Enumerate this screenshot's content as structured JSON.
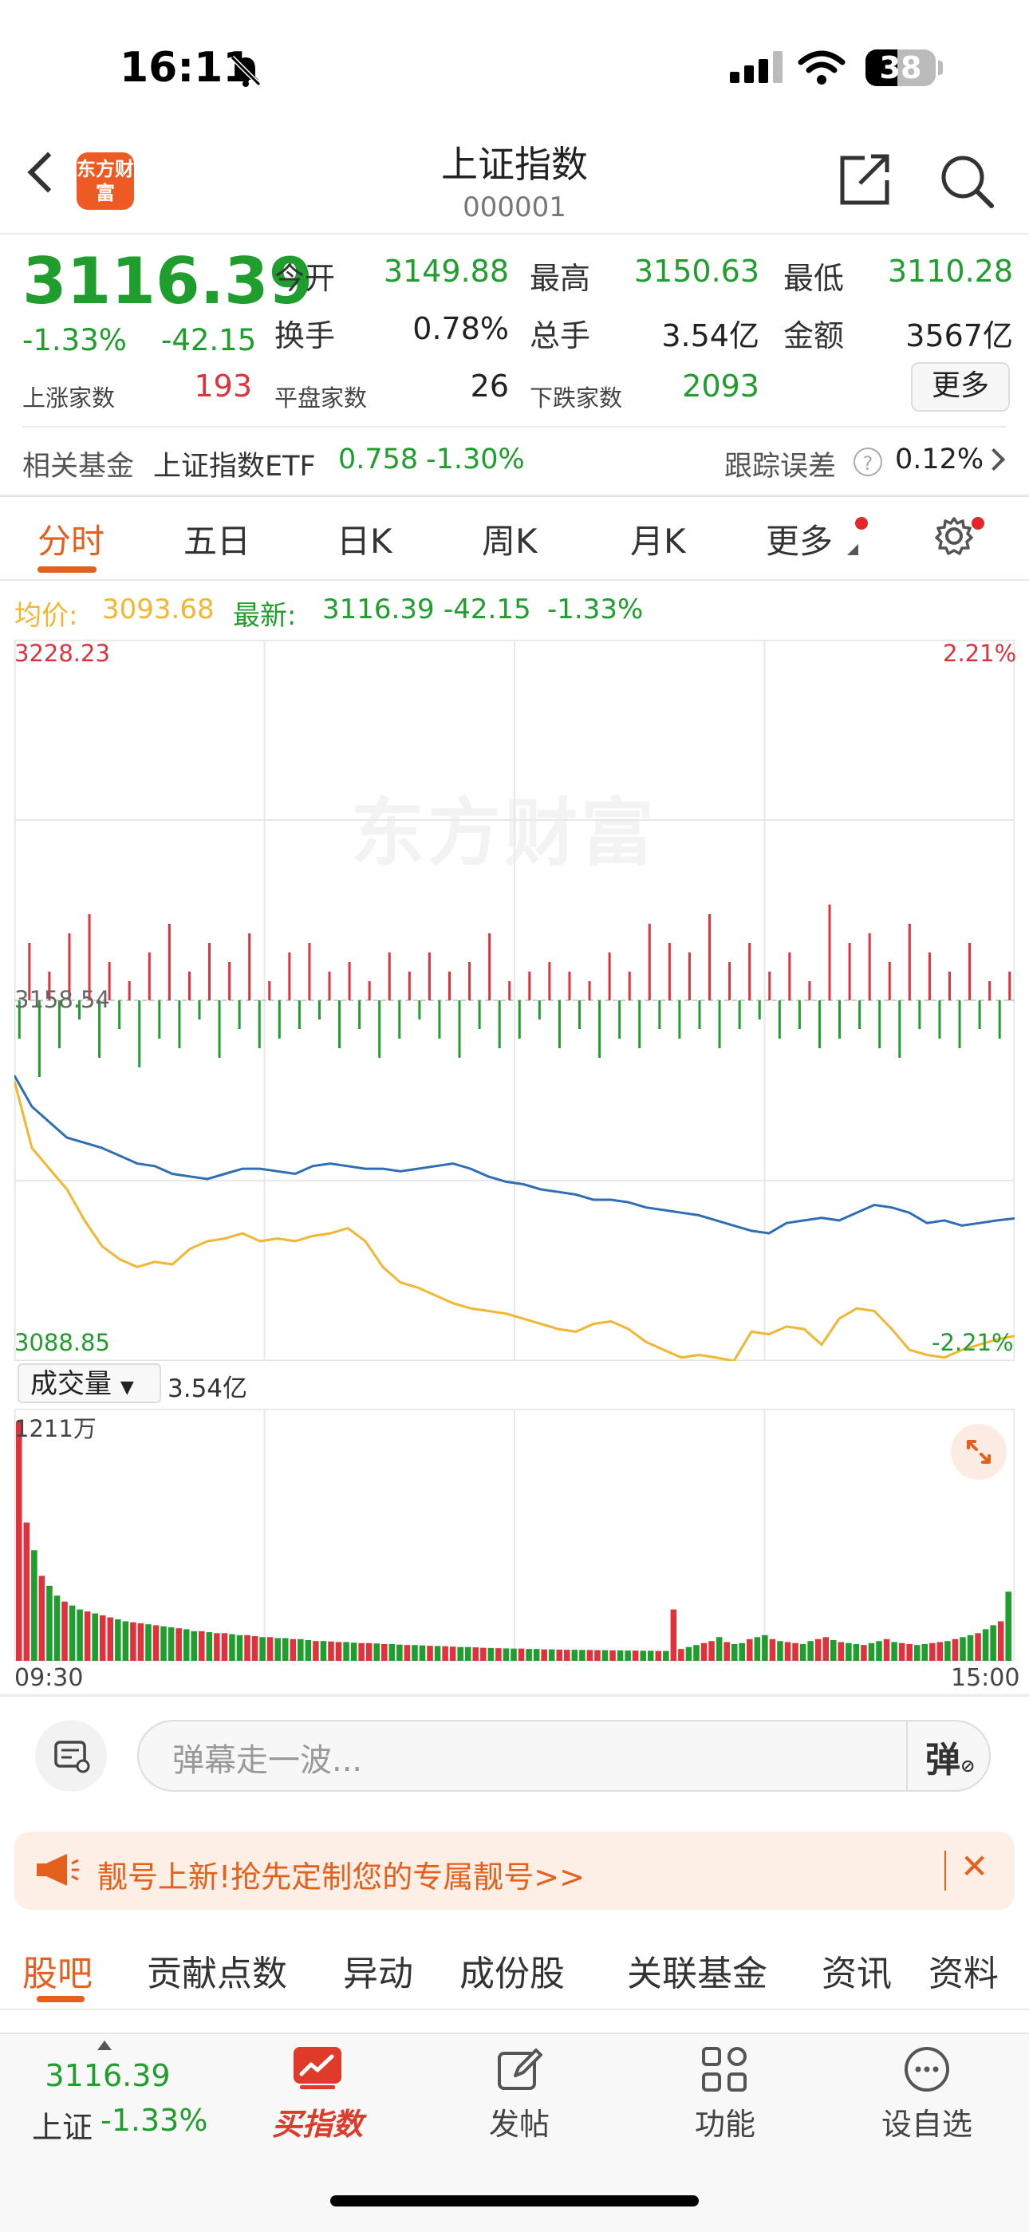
{
  "status_bar": {
    "time": "16:11",
    "battery": "38"
  },
  "header": {
    "title": "上证指数",
    "code": "000001",
    "logo_text": "东方财富"
  },
  "quote": {
    "price": "3116.39",
    "change_pct": "-1.33%",
    "change": "-42.15",
    "stats": [
      {
        "label": "今开",
        "value": "3149.88"
      },
      {
        "label": "最高",
        "value": "3150.63"
      },
      {
        "label": "最低",
        "value": "3110.28"
      },
      {
        "label": "换手",
        "value": "0.78%"
      },
      {
        "label": "总手",
        "value": "3.54亿"
      },
      {
        "label": "金额",
        "value": "3567亿"
      }
    ],
    "breadth": [
      {
        "label": "上涨家数",
        "value": "193"
      },
      {
        "label": "平盘家数",
        "value": "26"
      },
      {
        "label": "下跌家数",
        "value": "2093"
      }
    ],
    "more_label": "更多"
  },
  "fund": {
    "label": "相关基金",
    "name": "上证指数ETF",
    "price": "0.758",
    "pct": "-1.30%",
    "tracking_label": "跟踪误差",
    "tracking_value": "0.12%"
  },
  "chart_tabs": [
    "分时",
    "五日",
    "日K",
    "周K",
    "月K",
    "更多"
  ],
  "legend": {
    "avg_label": "均价:",
    "avg_value": "3093.68",
    "latest_label": "最新:",
    "latest_value": "3116.39",
    "latest_change": "-42.15",
    "latest_pct": "-1.33%"
  },
  "chart_labels": {
    "top_left": "3228.23",
    "top_right": "2.21%",
    "mid_left": "3158.54",
    "bottom_left": "3088.85",
    "bottom_right": "-2.21%",
    "watermark": "东方财富"
  },
  "volume": {
    "selector": "成交量",
    "amount": "3.54亿",
    "max_label": "1211万",
    "start_time": "09:30",
    "end_time": "15:00"
  },
  "danmaku": {
    "placeholder": "弹幕走一波...",
    "button": "弹"
  },
  "promo": {
    "text": "靓号上新!抢先定制您的专属靓号>>"
  },
  "bottom_tabs": [
    "股吧",
    "贡献点数",
    "异动",
    "成份股",
    "关联基金",
    "资讯",
    "资料"
  ],
  "bottom_nav": {
    "index_price": "3116.39",
    "index_name": "上证",
    "index_pct": "-1.33%",
    "items": [
      "买指数",
      "发帖",
      "功能",
      "设自选"
    ]
  },
  "colors": {
    "up": "#e0323c",
    "down": "#1f9e2d",
    "accent": "#e5601c",
    "price_line": "#2f6db5",
    "avg_line": "#f2b632"
  },
  "chart_data": {
    "type": "line",
    "ylim": [
      3088.85,
      3228.23
    ],
    "y_pct_range": [
      "-2.21%",
      "2.21%"
    ],
    "prev_close": 3158.54,
    "x_range": [
      "09:30",
      "15:00"
    ],
    "series": [
      {
        "name": "最新",
        "values": [
          3144.0,
          3138.0,
          3135.0,
          3132.0,
          3131.0,
          3130.0,
          3128.5,
          3127.0,
          3126.5,
          3125.0,
          3124.5,
          3124.0,
          3125.0,
          3126.0,
          3126.0,
          3125.5,
          3125.0,
          3126.5,
          3127.0,
          3126.5,
          3126.0,
          3126.0,
          3125.5,
          3126.0,
          3126.5,
          3127.0,
          3126.0,
          3124.5,
          3123.5,
          3123.0,
          3122.0,
          3121.5,
          3121.0,
          3120.0,
          3120.0,
          3119.5,
          3118.5,
          3118.0,
          3117.5,
          3117.0,
          3116.0,
          3115.0,
          3114.0,
          3113.5,
          3115.5,
          3116.0,
          3116.5,
          3116.0,
          3117.5,
          3119.0,
          3118.5,
          3117.5,
          3115.5,
          3116.0,
          3115.0,
          3115.5,
          3116.0,
          3116.39
        ]
      },
      {
        "name": "均价",
        "values": [
          3143.0,
          3130.0,
          3126.0,
          3122.0,
          3116.0,
          3111.0,
          3108.5,
          3107.0,
          3108.0,
          3107.5,
          3110.5,
          3112.0,
          3112.5,
          3113.5,
          3112.0,
          3112.5,
          3112.0,
          3113.0,
          3113.5,
          3114.5,
          3112.0,
          3107.0,
          3104.0,
          3103.0,
          3101.5,
          3100.0,
          3099.0,
          3098.5,
          3098.0,
          3097.0,
          3096.0,
          3095.0,
          3094.5,
          3096.0,
          3096.5,
          3095.0,
          3092.5,
          3091.0,
          3089.5,
          3090.0,
          3089.5,
          3088.85,
          3094.5,
          3094.0,
          3095.5,
          3095.0,
          3092.0,
          3097.0,
          3099.0,
          3098.5,
          3095.0,
          3091.0,
          3090.0,
          3089.5,
          3091.0,
          3092.0,
          3093.0,
          3093.68
        ]
      }
    ],
    "breadth_bars": [
      -0.4,
      0.6,
      -0.8,
      0.3,
      -0.5,
      0.7,
      -0.2,
      0.9,
      -0.6,
      0.4,
      -0.3,
      0.2,
      -0.7,
      0.5,
      -0.4,
      0.8,
      -0.5,
      0.3,
      -0.2,
      0.6,
      -0.6,
      0.4,
      -0.3,
      0.7,
      -0.5,
      0.2,
      -0.4,
      0.5,
      -0.3,
      0.6,
      -0.2,
      0.3,
      -0.5,
      0.4,
      -0.3,
      0.2,
      -0.6,
      0.5,
      -0.4,
      0.3,
      -0.2,
      0.5,
      -0.4,
      0.3,
      -0.6,
      0.4,
      -0.3,
      0.7,
      -0.5,
      0.2,
      -0.4,
      0.3,
      -0.2,
      0.4,
      -0.5,
      0.3,
      -0.3,
      0.2,
      -0.6,
      0.5,
      -0.4,
      0.3,
      -0.5,
      0.8,
      -0.3,
      0.6,
      -0.4,
      0.5,
      -0.3,
      0.9,
      -0.5,
      0.4,
      -0.3,
      0.6,
      -0.2,
      0.3,
      -0.4,
      0.5,
      -0.3,
      0.2,
      -0.5,
      1.0,
      -0.4,
      0.6,
      -0.3,
      0.7,
      -0.5,
      0.4,
      -0.6,
      0.8,
      -0.3,
      0.5,
      -0.4,
      0.3,
      -0.5,
      0.6,
      -0.3,
      0.2,
      -0.4,
      0.3
    ],
    "volume_max": 1211,
    "volume_unit": "万",
    "volume": [
      1211,
      700,
      560,
      430,
      380,
      330,
      300,
      280,
      260,
      250,
      240,
      230,
      220,
      210,
      200,
      195,
      190,
      185,
      180,
      175,
      170,
      165,
      160,
      150,
      150,
      145,
      140,
      140,
      135,
      130,
      130,
      125,
      120,
      120,
      115,
      115,
      110,
      110,
      105,
      100,
      100,
      98,
      95,
      95,
      92,
      90,
      90,
      88,
      85,
      85,
      82,
      80,
      80,
      78,
      76,
      75,
      74,
      72,
      70,
      70,
      68,
      66,
      65,
      64,
      63,
      62,
      62,
      60,
      60,
      58,
      58,
      57,
      56,
      56,
      55,
      55,
      54,
      54,
      53,
      53,
      52,
      52,
      51,
      51,
      50,
      50,
      260,
      60,
      70,
      80,
      90,
      100,
      120,
      95,
      85,
      90,
      110,
      120,
      130,
      110,
      100,
      95,
      90,
      85,
      100,
      110,
      120,
      105,
      95,
      90,
      85,
      80,
      90,
      100,
      110,
      95,
      90,
      85,
      80,
      85,
      90,
      95,
      100,
      110,
      120,
      130,
      140,
      160,
      180,
      200,
      350
    ]
  }
}
